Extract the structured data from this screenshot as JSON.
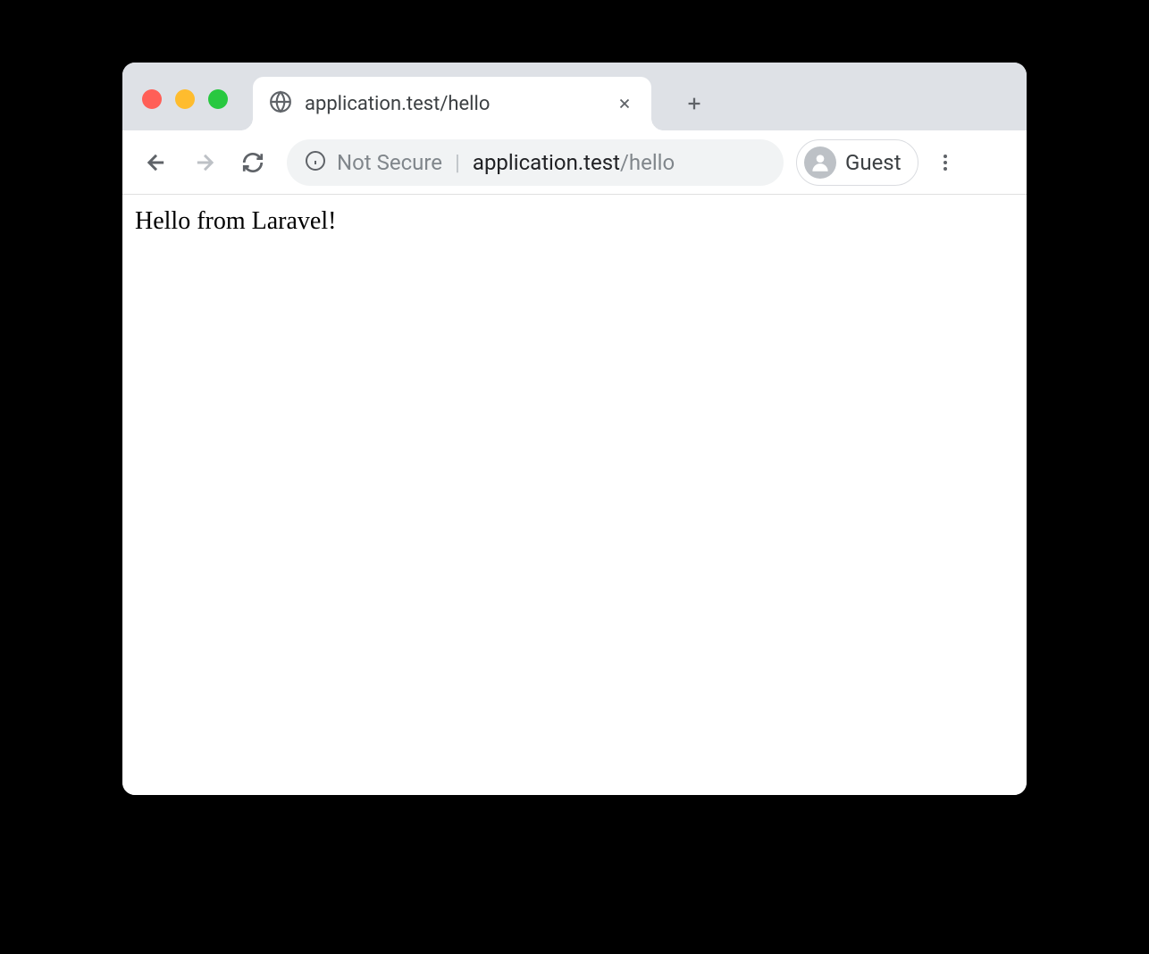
{
  "tab": {
    "title": "application.test/hello"
  },
  "address": {
    "security_label": "Not Secure",
    "host": "application.test",
    "path": "/hello"
  },
  "profile": {
    "label": "Guest"
  },
  "page": {
    "content": "Hello from Laravel!"
  }
}
